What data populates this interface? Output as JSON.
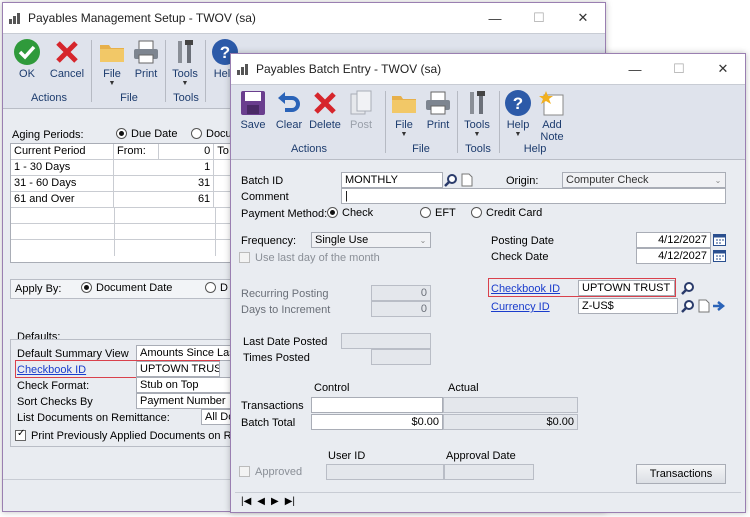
{
  "setup_window": {
    "title": "Payables Management Setup  -  TWOV (sa)",
    "ribbon": {
      "ok": "OK",
      "cancel": "Cancel",
      "actions_group": "Actions",
      "file": "File",
      "print": "Print",
      "file_group": "File",
      "tools": "Tools",
      "tools_group": "Tools",
      "help": "Help"
    },
    "aging_label": "Aging Periods:",
    "aging_due_date": "Due Date",
    "aging_doc": "Docu",
    "aging_headers": [
      "Current Period",
      "From:",
      "0",
      "To"
    ],
    "aging_rows": [
      {
        "name": "1 - 30 Days",
        "from": "1"
      },
      {
        "name": "31 - 60 Days",
        "from": "31"
      },
      {
        "name": "61 and Over",
        "from": "61"
      }
    ],
    "apply_by_label": "Apply By:",
    "apply_by_doc_date": "Document Date",
    "apply_by_d": "D",
    "defaults_label": "Defaults:",
    "defaults_rows": [
      {
        "label": "Default Summary View",
        "value": "Amounts Since Last C"
      },
      {
        "label": "Checkbook ID",
        "value": "UPTOWN TRUST"
      },
      {
        "label": "Check Format:",
        "value": "Stub on Top"
      },
      {
        "label": "Sort Checks By",
        "value": "Payment Number"
      },
      {
        "label": "List Documents on Remittance:",
        "value": "All Do"
      }
    ],
    "print_prev": "Print Previously Applied Documents on Remittan"
  },
  "batch_window": {
    "title": "Payables Batch Entry  -  TWOV (sa)",
    "ribbon": {
      "save": "Save",
      "clear": "Clear",
      "delete": "Delete",
      "post": "Post",
      "actions_group": "Actions",
      "file": "File",
      "print": "Print",
      "file_group": "File",
      "tools": "Tools",
      "tools_group": "Tools",
      "help": "Help",
      "add_note_1": "Add",
      "add_note_2": "Note",
      "help_group": "Help"
    },
    "batch_id_label": "Batch ID",
    "batch_id_value": "MONTHLY",
    "origin_label": "Origin:",
    "origin_value": "Computer Check",
    "comment_label": "Comment",
    "comment_value": "|",
    "payment_method_label": "Payment Method:",
    "pm_check": "Check",
    "pm_eft": "EFT",
    "pm_credit": "Credit Card",
    "frequency_label": "Frequency:",
    "frequency_value": "Single Use",
    "use_last_day": "Use last day of the month",
    "posting_date_label": "Posting Date",
    "posting_date_value": "4/12/2027",
    "check_date_label": "Check Date",
    "check_date_value": "4/12/2027",
    "recurring_label": "Recurring Posting",
    "recurring_value": "0",
    "days_inc_label": "Days to Increment",
    "days_inc_value": "0",
    "checkbook_label": "Checkbook ID",
    "checkbook_value": "UPTOWN TRUST",
    "currency_label": "Currency ID",
    "currency_value": "Z-US$",
    "last_date_label": "Last Date Posted",
    "times_posted_label": "Times Posted",
    "control_label": "Control",
    "actual_label": "Actual",
    "transactions_label": "Transactions",
    "batch_total_label": "Batch Total",
    "batch_total_control": "$0.00",
    "batch_total_actual": "$0.00",
    "user_id_label": "User ID",
    "approval_date_label": "Approval Date",
    "approved_label": "Approved",
    "transactions_button": "Transactions"
  }
}
